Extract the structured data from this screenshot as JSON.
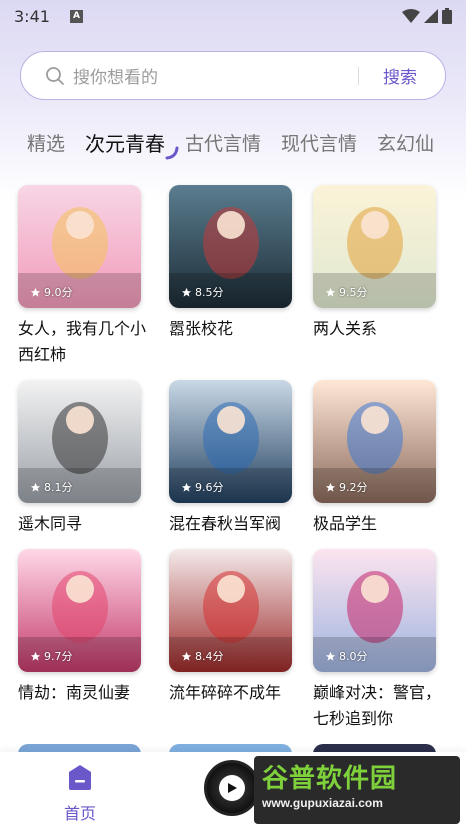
{
  "status": {
    "time": "3:41",
    "notification": "A"
  },
  "search": {
    "placeholder": "搜你想看的",
    "button": "搜索"
  },
  "tabs": [
    {
      "label": "精选"
    },
    {
      "label": "次元青春"
    },
    {
      "label": "古代言情"
    },
    {
      "label": "现代言情"
    },
    {
      "label": "玄幻仙"
    }
  ],
  "books": [
    {
      "title": "女人，我有几个小西红柿",
      "rating": "9.0分",
      "bg1": "#f7d6e6",
      "bg2": "#f29ab9",
      "art": "#f4c35a"
    },
    {
      "title": "嚣张校花",
      "rating": "8.5分",
      "bg1": "#5a7d8f",
      "bg2": "#1d2c36",
      "art": "#c23a3a"
    },
    {
      "title": "两人关系",
      "rating": "9.5分",
      "bg1": "#fbf3d8",
      "bg2": "#dfe8d0",
      "art": "#e2a33a"
    },
    {
      "title": "遥木同寻",
      "rating": "8.1分",
      "bg1": "#f2f2f2",
      "bg2": "#9aa0a8",
      "art": "#333333"
    },
    {
      "title": "混在春秋当军阀",
      "rating": "9.6分",
      "bg1": "#c9d8e6",
      "bg2": "#22405f",
      "art": "#2e6bb5"
    },
    {
      "title": "极品学生",
      "rating": "9.2分",
      "bg1": "#ffe7d6",
      "bg2": "#8a6a5c",
      "art": "#3f7ad1"
    },
    {
      "title": "情劫：南灵仙妻",
      "rating": "9.7分",
      "bg1": "#ffd8e8",
      "bg2": "#c33a6a",
      "art": "#e3466e"
    },
    {
      "title": "流年碎碎不成年",
      "rating": "8.4分",
      "bg1": "#f4eaea",
      "bg2": "#9d2a2a",
      "art": "#d63232"
    },
    {
      "title": "巅峰对决：警官，七秒追到你",
      "rating": "8.0分",
      "bg1": "#fce4ef",
      "bg2": "#9fb4e0",
      "art": "#c4246a"
    }
  ],
  "nav": {
    "home_label": "首页"
  },
  "watermark": {
    "title": "谷普软件园",
    "url": "www.gupuxiazai.com"
  },
  "colors": {
    "accent": "#6a57c9",
    "search_border": "#b9b3e3"
  }
}
